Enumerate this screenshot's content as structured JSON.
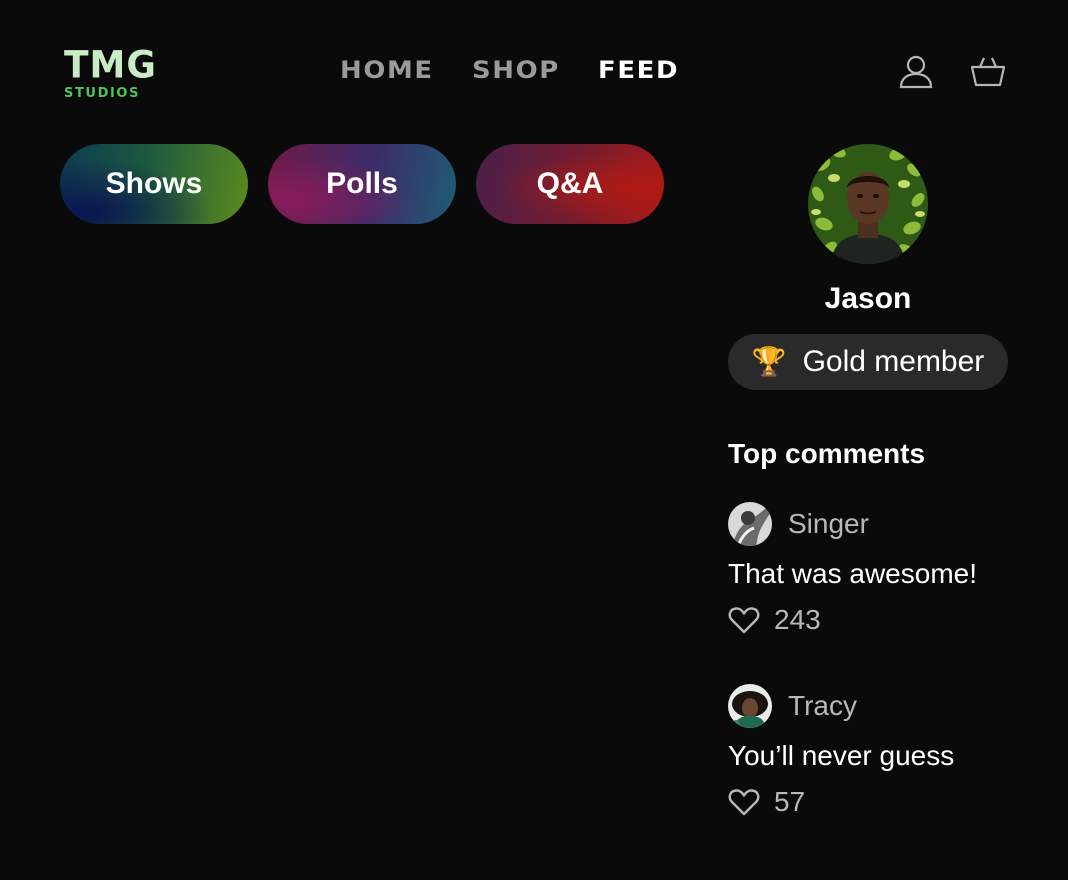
{
  "logo": {
    "title": "TMG",
    "subtitle": "STUDIOS"
  },
  "nav": {
    "items": [
      "HOME",
      "SHOP",
      "FEED"
    ],
    "active": "FEED"
  },
  "header_icons": [
    "user-icon",
    "basket-icon"
  ],
  "categories": [
    "Shows",
    "Polls",
    "Q&A"
  ],
  "profile": {
    "name": "Jason",
    "badge_icon": "trophy-icon",
    "badge_label": "Gold member"
  },
  "comments_section": {
    "title": "Top comments",
    "items": [
      {
        "author": "Singer",
        "text": "That was awesome!",
        "likes": "243"
      },
      {
        "author": "Tracy",
        "text": "You’ll never guess",
        "likes": "57"
      }
    ]
  },
  "colors": {
    "background": "#0a0a0a",
    "logo_main": "#c9ecc6",
    "logo_sub": "#4fc25a",
    "nav_inactive": "#9a9a9a",
    "badge_bg": "#2a2a2a"
  }
}
